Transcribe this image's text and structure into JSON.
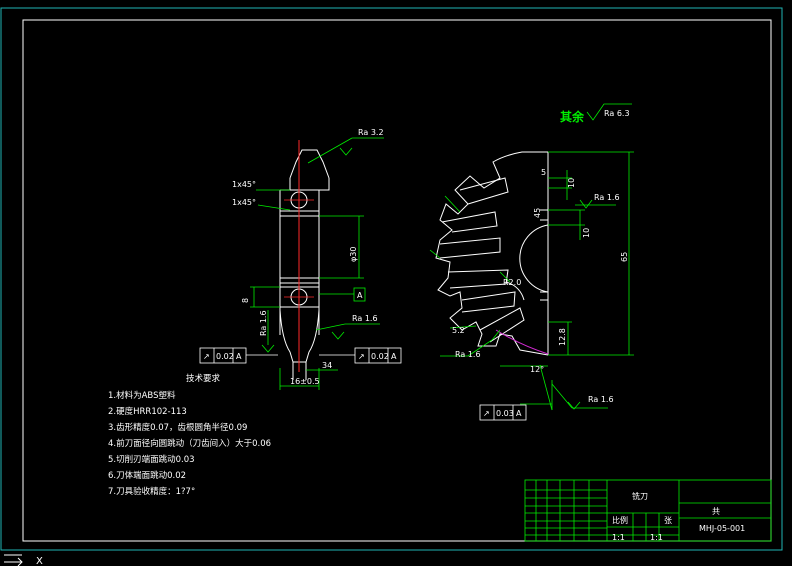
{
  "drawing": {
    "colors": {
      "background": "#000000",
      "border": "#1fb4b4",
      "part_outline": "#ffffff",
      "centerline": "#ff2a2a",
      "dimension": "#00ee00",
      "title_block_lines": "#00ee00",
      "arc_highlight": "#d42ad4"
    },
    "annotations": {
      "ra_32": "Ra 3.2",
      "ra_63": "Ra 6.3",
      "other_label": "其余",
      "chamfer_1": "1x45°",
      "chamfer_2": "1x45°",
      "ra_16_left": "Ra 1.6",
      "ra_16_left2": "Ra 1.6",
      "ra_16_mid": "Ra 1.6",
      "ra_16_gear_bottom": "Ra 1.6",
      "ra_16_gear_right": "Ra 1.6",
      "ra_16_bottom": "Ra 1.6",
      "datum_a": "A",
      "dim_phi30": "φ30",
      "dim_34": "34",
      "dim_16": "16±0.5",
      "dim_45": "45",
      "dim_5": "5",
      "dim_10": "10",
      "dim_10_2": "10",
      "dim_65": "65",
      "dim_128": "12.8",
      "dim_52": "5.2",
      "dim_12deg": "12°",
      "dim_r20": "R2.0",
      "dim_8": "8"
    },
    "tolerance_frames": [
      {
        "id": "frame-left",
        "symbol": "↗",
        "value": "0.02",
        "datum": "A"
      },
      {
        "id": "frame-mid",
        "symbol": "↗",
        "value": "0.02",
        "datum": "A"
      },
      {
        "id": "frame-bottom",
        "symbol": "↗",
        "value": "0.03",
        "datum": "A"
      }
    ],
    "technical_requirements": {
      "heading": "技术要求",
      "items": [
        "1.材料为ABS塑料",
        "2.硬度HRR102-113",
        "3.齿形精度0.07，齿根圆角半径0.09",
        "4.前刀面径向圆跳动（刀齿间入）大于0.06",
        "5.切削刃端面跳动0.03",
        "6.刀体端面跳动0.02",
        "7.刀具验收精度：1?7°"
      ]
    },
    "title_block": {
      "part_name": "铣刀",
      "drawing_number": "MHJ-05-001",
      "scale_label": "1:1",
      "material_cell": "比例",
      "sheet_cell": "1:1",
      "row_small_1": "共",
      "row_small_2": "张"
    },
    "status_bar": {
      "icon_label": "X"
    }
  }
}
